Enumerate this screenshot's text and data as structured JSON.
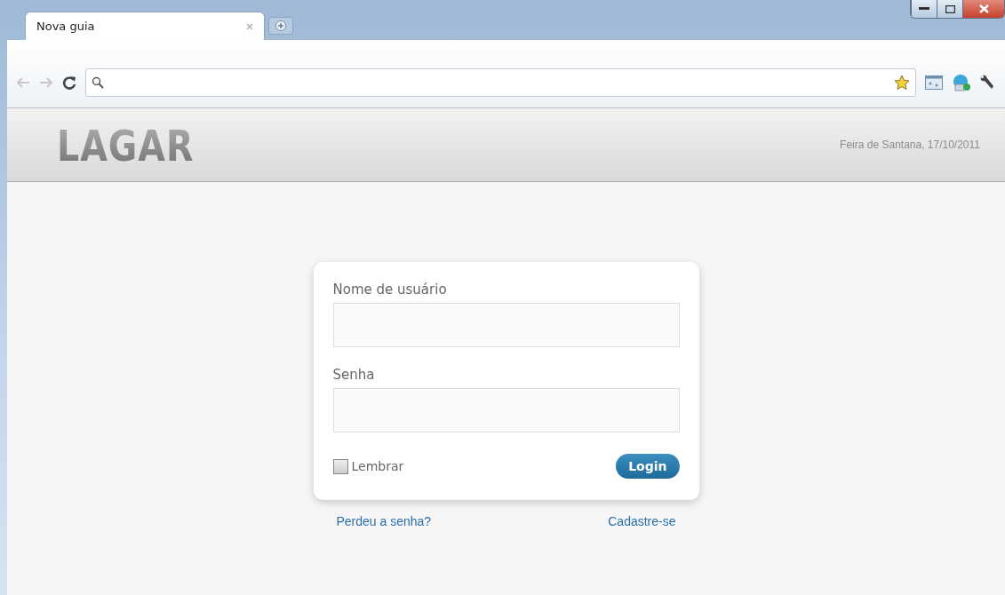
{
  "browser": {
    "tabs": [
      {
        "title": "Nova guia",
        "selected": true
      }
    ]
  },
  "header": {
    "logo": "LAGAR",
    "location_date": "Feira de Santana, 17/10/2011"
  },
  "login_form": {
    "fields": [
      {
        "label": "Nome de usuário"
      },
      {
        "label": "Senha"
      }
    ],
    "remember": {
      "label": "Lembrar",
      "checked": false
    },
    "submit": "Login",
    "links": [
      "Perdeu a senha?",
      "Cadastre-se"
    ]
  }
}
